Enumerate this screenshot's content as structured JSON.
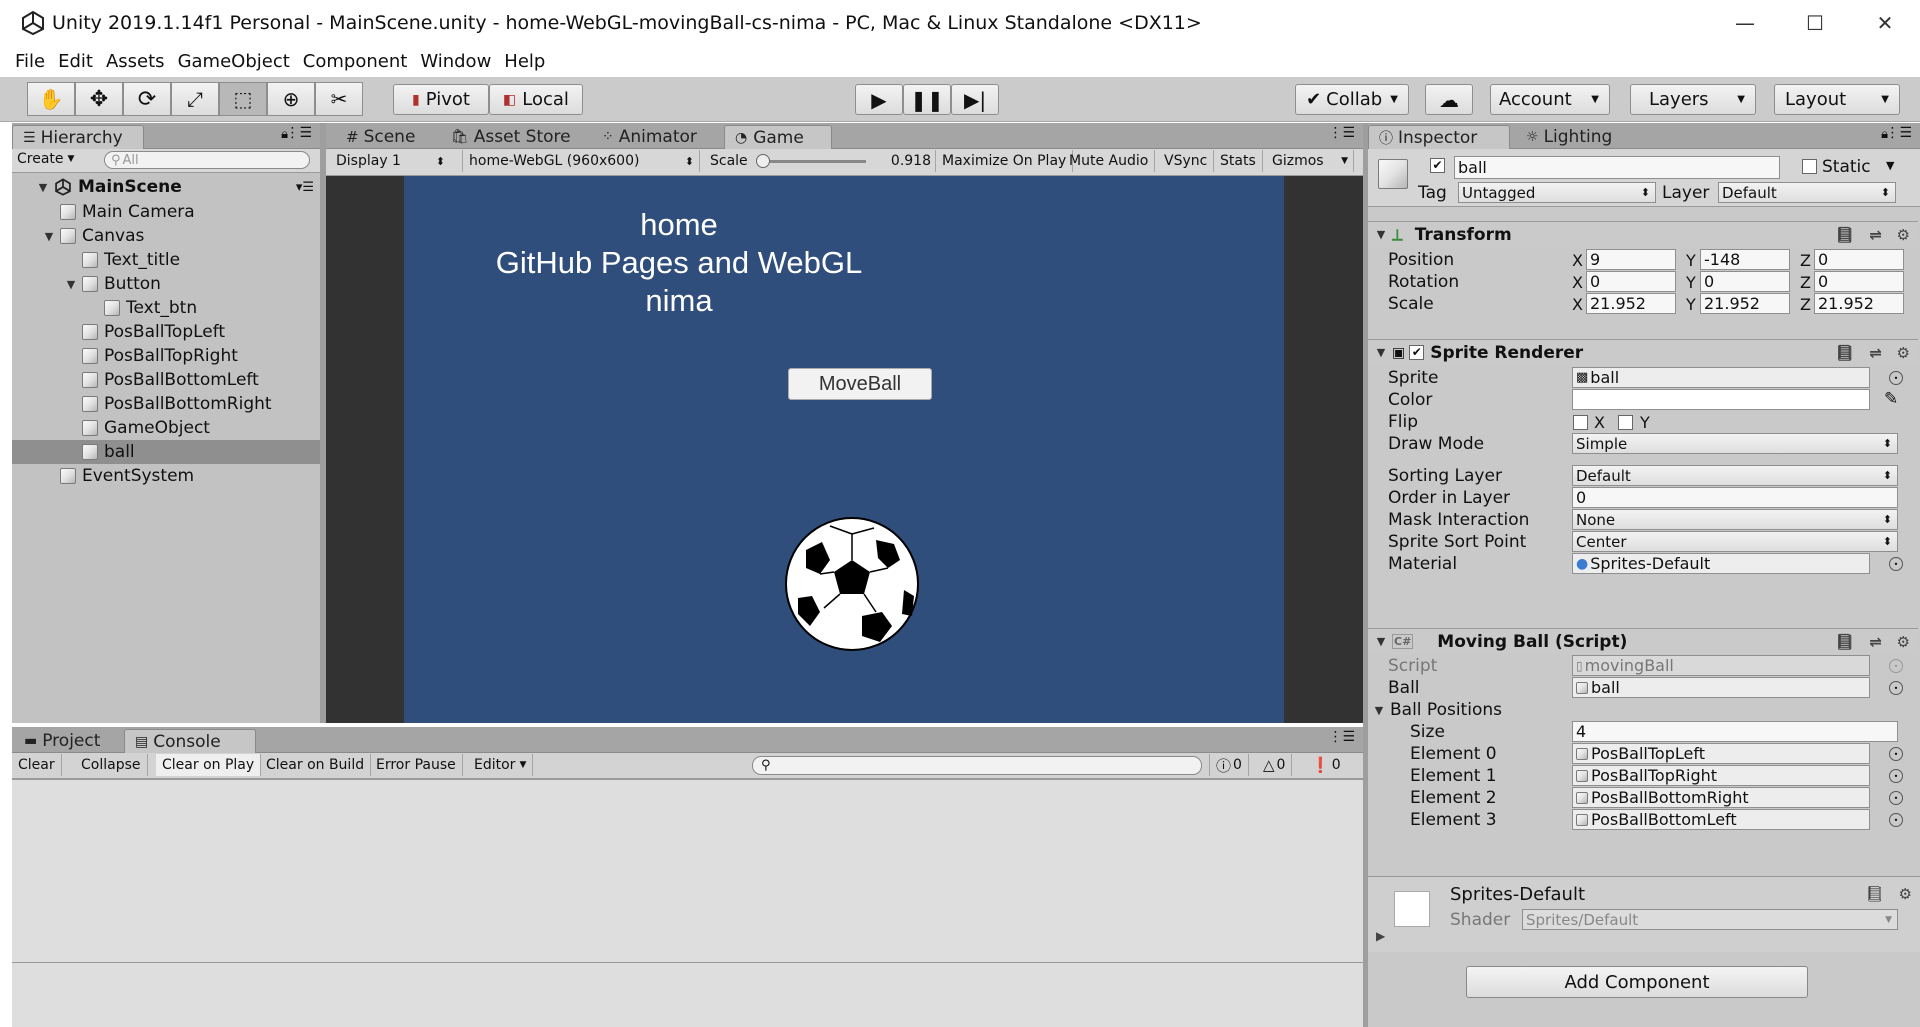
{
  "window": {
    "title": "Unity 2019.1.14f1 Personal - MainScene.unity - home-WebGL-movingBall-cs-nima - PC, Mac & Linux Standalone <DX11>",
    "controls": {
      "minimize": "—",
      "maximize": "☐",
      "close": "✕"
    }
  },
  "menu": [
    "File",
    "Edit",
    "Assets",
    "GameObject",
    "Component",
    "Window",
    "Help"
  ],
  "toolbar": {
    "tools": [
      "hand-tool",
      "move-tool",
      "rotate-tool",
      "scale-tool",
      "rect-tool",
      "transform-tool",
      "custom-tool"
    ],
    "pivot": "Pivot",
    "local": "Local",
    "collab": "Collab",
    "account": "Account",
    "layers": "Layers",
    "layout": "Layout"
  },
  "hierarchy": {
    "tab": "Hierarchy",
    "create": "Create",
    "search_placeholder": "All",
    "scene": "MainScene",
    "items": [
      {
        "label": "Main Camera",
        "depth": 1,
        "arrow": ""
      },
      {
        "label": "Canvas",
        "depth": 1,
        "arrow": "▼"
      },
      {
        "label": "Text_title",
        "depth": 2,
        "arrow": ""
      },
      {
        "label": "Button",
        "depth": 2,
        "arrow": "▼"
      },
      {
        "label": "Text_btn",
        "depth": 3,
        "arrow": ""
      },
      {
        "label": "PosBallTopLeft",
        "depth": 2,
        "arrow": ""
      },
      {
        "label": "PosBallTopRight",
        "depth": 2,
        "arrow": ""
      },
      {
        "label": "PosBallBottomLeft",
        "depth": 2,
        "arrow": ""
      },
      {
        "label": "PosBallBottomRight",
        "depth": 2,
        "arrow": ""
      },
      {
        "label": "GameObject",
        "depth": 2,
        "arrow": ""
      },
      {
        "label": "ball",
        "depth": 2,
        "arrow": "",
        "selected": true
      },
      {
        "label": "EventSystem",
        "depth": 1,
        "arrow": ""
      }
    ]
  },
  "center": {
    "tabs": [
      "Scene",
      "Asset Store",
      "Animator",
      "Game"
    ],
    "active_tab": "Game",
    "display": "Display 1",
    "resolution": "home-WebGL (960x600)",
    "scale_label": "Scale",
    "scale_value": "0.918",
    "scale_fraction": 0.02,
    "maximize": "Maximize On Play",
    "mute": "Mute Audio",
    "vsync": "VSync",
    "stats": "Stats",
    "gizmos": "Gizmos",
    "game": {
      "line1": "home",
      "line2": "GitHub Pages and WebGL",
      "line3": "nima",
      "button": "MoveBall"
    }
  },
  "bottom": {
    "tabs": [
      "Project",
      "Console"
    ],
    "active_tab": "Console",
    "buttons": [
      "Clear",
      "Collapse",
      "Clear on Play",
      "Clear on Build",
      "Error Pause",
      "Editor"
    ],
    "counts": {
      "info": "0",
      "warn": "0",
      "error": "0"
    }
  },
  "inspector": {
    "tabs": [
      "Inspector",
      "Lighting"
    ],
    "name": "ball",
    "static_label": "Static",
    "tag_label": "Tag",
    "tag": "Untagged",
    "layer_label": "Layer",
    "layer": "Default",
    "transform": {
      "title": "Transform",
      "rows": [
        {
          "label": "Position",
          "x": "9",
          "y": "-148",
          "z": "0"
        },
        {
          "label": "Rotation",
          "x": "0",
          "y": "0",
          "z": "0"
        },
        {
          "label": "Scale",
          "x": "21.952",
          "y": "21.952",
          "z": "21.952"
        }
      ]
    },
    "sprite_renderer": {
      "title": "Sprite Renderer",
      "sprite_label": "Sprite",
      "sprite": "ball",
      "color_label": "Color",
      "color": "#ffffff",
      "flip_label": "Flip",
      "flip_x": "X",
      "flip_y": "Y",
      "draw_mode_label": "Draw Mode",
      "draw_mode": "Simple",
      "sorting_layer_label": "Sorting Layer",
      "sorting_layer": "Default",
      "order_label": "Order in Layer",
      "order": "0",
      "mask_label": "Mask Interaction",
      "mask": "None",
      "sort_point_label": "Sprite Sort Point",
      "sort_point": "Center",
      "material_label": "Material",
      "material": "Sprites-Default"
    },
    "moving_ball": {
      "title": "Moving Ball (Script)",
      "script_label": "Script",
      "script": "movingBall",
      "ball_label": "Ball",
      "ball": "ball",
      "positions_label": "Ball Positions",
      "size_label": "Size",
      "size": "4",
      "elements": [
        {
          "label": "Element 0",
          "value": "PosBallTopLeft"
        },
        {
          "label": "Element 1",
          "value": "PosBallTopRight"
        },
        {
          "label": "Element 2",
          "value": "PosBallBottomRight"
        },
        {
          "label": "Element 3",
          "value": "PosBallBottomLeft"
        }
      ]
    },
    "material": {
      "title": "Sprites-Default",
      "shader_label": "Shader",
      "shader": "Sprites/Default"
    },
    "add_component": "Add Component"
  }
}
